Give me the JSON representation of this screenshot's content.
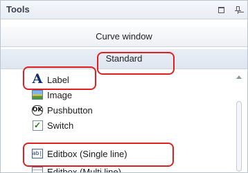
{
  "panel": {
    "title": "Tools",
    "float_icon": "float-window-icon",
    "pin_icon": "pin-icon"
  },
  "sections": {
    "curve_window": "Curve window",
    "standard": "Standard"
  },
  "items": [
    {
      "label": "Label",
      "icon": "label-icon"
    },
    {
      "label": "Image",
      "icon": "image-icon"
    },
    {
      "label": "Pushbutton",
      "icon": "pushbutton-icon"
    },
    {
      "label": "Switch",
      "icon": "switch-icon"
    },
    {
      "label": "Editbox (Single line)",
      "icon": "editbox-single-icon"
    },
    {
      "label": "Editbox (Multi line)",
      "icon": "editbox-multi-icon"
    }
  ],
  "icon_glyphs": {
    "label": "A",
    "pushbutton": "OK",
    "switch": "✓",
    "editbox": "ab|"
  },
  "colors": {
    "highlight": "#e02020",
    "title_bar": "#e8edf4",
    "section": "#dfe6f0"
  }
}
